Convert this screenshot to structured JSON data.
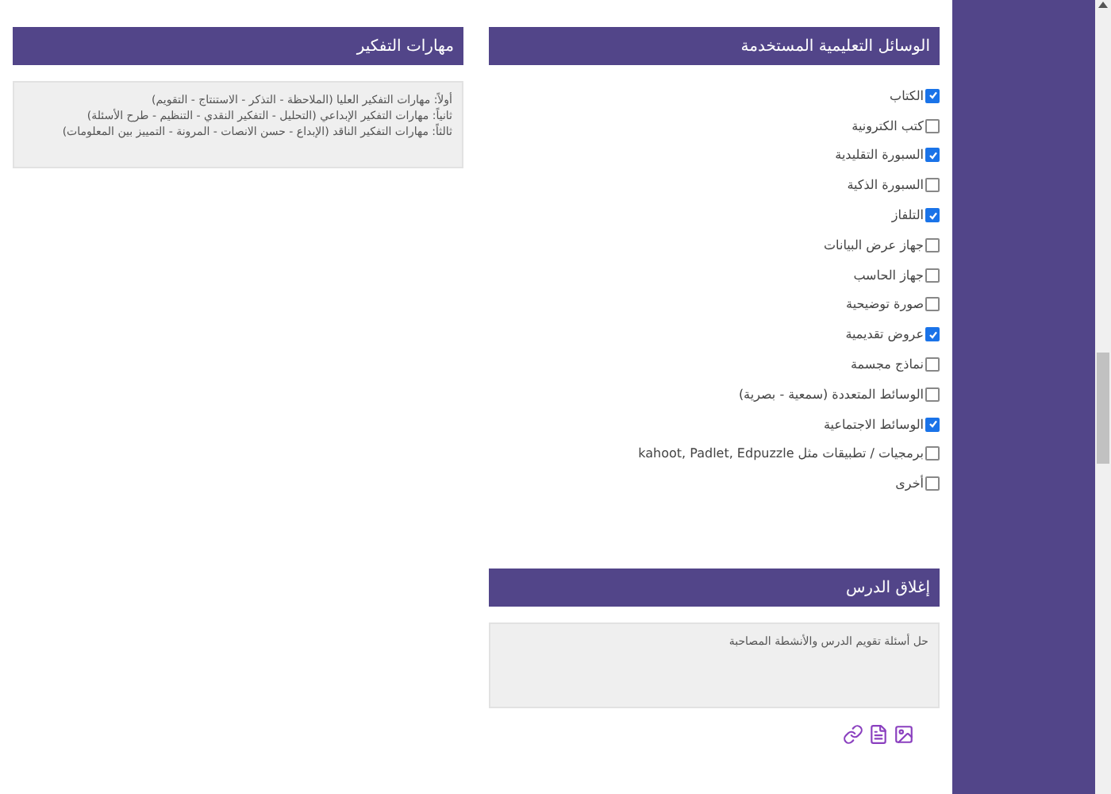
{
  "teaching_aids": {
    "title": "الوسائل التعليمية المستخدمة",
    "items": [
      {
        "label": "الكتاب",
        "checked": true
      },
      {
        "label": "كتب الكترونية",
        "checked": false
      },
      {
        "label": "السبورة التقليدية",
        "checked": true
      },
      {
        "label": "السبورة الذكية",
        "checked": false
      },
      {
        "label": "التلفاز",
        "checked": true
      },
      {
        "label": "جهاز عرض البيانات",
        "checked": false
      },
      {
        "label": "جهاز الحاسب",
        "checked": false
      },
      {
        "label": "صورة توضيحية",
        "checked": false
      },
      {
        "label": "عروض تقديمية",
        "checked": true
      },
      {
        "label": "نماذج مجسمة",
        "checked": false
      },
      {
        "label": "الوسائط المتعددة (سمعية - بصرية)",
        "checked": false
      },
      {
        "label": "الوسائط الاجتماعية",
        "checked": true
      },
      {
        "label": "برمجيات / تطبيقات مثل kahoot, Padlet, Edpuzzle",
        "checked": false
      },
      {
        "label": "أخرى",
        "checked": false
      }
    ]
  },
  "lesson_close": {
    "title": "إغلاق الدرس",
    "text": "حل أسئلة تقويم الدرس والأنشطة المصاحبة",
    "attachments": [
      {
        "kind": "image"
      },
      {
        "kind": "pdf"
      },
      {
        "kind": "link"
      }
    ]
  },
  "thinking_skills": {
    "title": "مهارات التفكير",
    "lines": [
      "أولاً: مهارات التفكير العليا (الملاحظة - التذكر - الاستنتاج - التقويم)",
      "ثانياً: مهارات التفكير الإبداعي (التحليل - التفكير النقدي - التنظيم - طرح الأسئلة)",
      "ثالثاً: مهارات التفكير الناقد (الإبداع - حسن الانصات - المرونة - التمييز بين المعلومات)"
    ]
  }
}
